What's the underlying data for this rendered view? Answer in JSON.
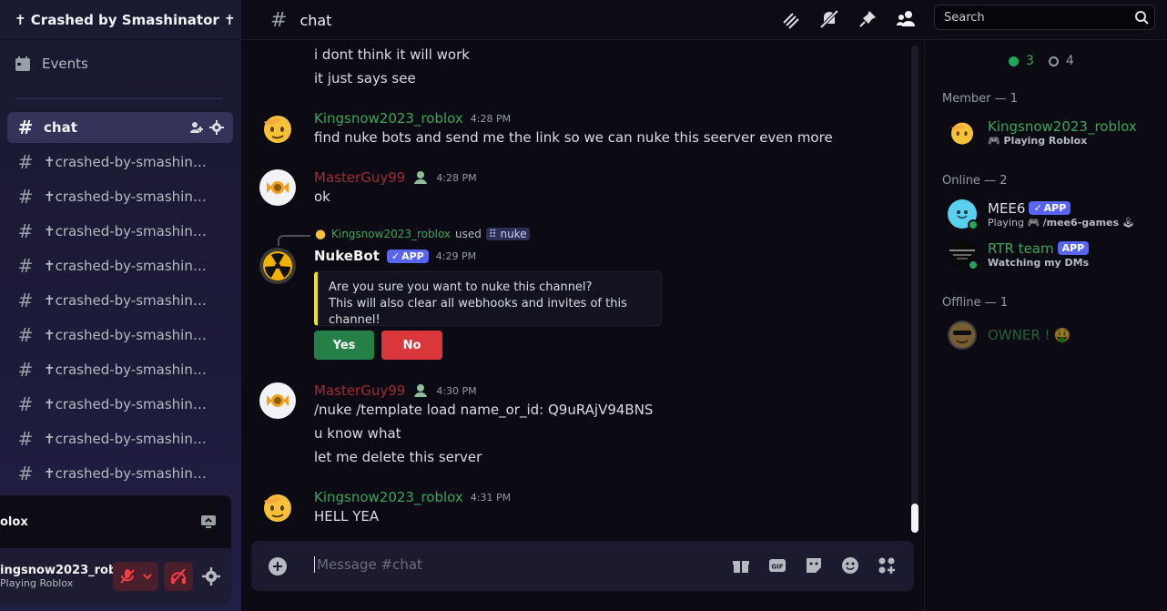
{
  "server": {
    "name": "✝ Crashed by Smashinator ✝"
  },
  "sidebar": {
    "events_label": "Events",
    "channels": [
      {
        "name": "chat",
        "active": true
      },
      {
        "name": "✝crashed-by-smashinator"
      },
      {
        "name": "✝crashed-by-smashinator"
      },
      {
        "name": "✝crashed-by-smashinator"
      },
      {
        "name": "✝crashed-by-smashinator"
      },
      {
        "name": "✝crashed-by-smashinator"
      },
      {
        "name": "✝crashed-by-smashinator"
      },
      {
        "name": "✝crashed-by-smashinator"
      },
      {
        "name": "✝crashed-by-smashinator"
      },
      {
        "name": "✝crashed-by-smashinator"
      },
      {
        "name": "✝crashed-by-smashinator"
      }
    ]
  },
  "user_panel": {
    "activity_name": "olox",
    "username": "ingsnow2023_rob...",
    "status": "Playing Roblox"
  },
  "header": {
    "channel": "chat",
    "search_placeholder": "Search"
  },
  "messages": {
    "m0_l1": "i dont think it will work",
    "m0_l2": "it just says see",
    "m1_author": "Kingsnow2023_roblox",
    "m1_time": "4:28 PM",
    "m1_text": "find nuke bots and send  me the link so we can nuke this seerver even more",
    "m2_author": "MasterGuy99",
    "m2_time": "4:28 PM",
    "m2_text": "ok",
    "m3_reply_user": "Kingsnow2023_roblox",
    "m3_reply_used": "used",
    "m3_reply_cmd": "nuke",
    "m3_author": "NukeBot",
    "m3_app": "APP",
    "m3_time": "4:29 PM",
    "m3_embed_l1": "Are you sure you want to nuke this channel?",
    "m3_embed_l2": "This will also clear all webhooks and invites of this channel!",
    "m3_yes": "Yes",
    "m3_no": "No",
    "m4_author": "MasterGuy99",
    "m4_time": "4:30 PM",
    "m4_l1": "/nuke /template load name_or_id: Q9uRAjV94BNS",
    "m4_l2": "u know what",
    "m4_l3": "let me delete this server",
    "m5_author": "Kingsnow2023_roblox",
    "m5_time": "4:31 PM",
    "m5_text": "HELL YEA"
  },
  "composer": {
    "placeholder": "Message #chat"
  },
  "members": {
    "online_count": "3",
    "offline_count": "4",
    "sec_member": "Member — 1",
    "sec_online": "Online — 2",
    "sec_offline": "Offline — 1",
    "kingsnow_name": "Kingsnow2023_roblox",
    "kingsnow_status": "Playing Roblox",
    "mee6_name": "MEE6",
    "mee6_app": "APP",
    "mee6_status_a": "Playing",
    "mee6_status_b": "/mee6-games",
    "rtr_name": "RTR team",
    "rtr_app": "APP",
    "rtr_status": "Watching my DMs",
    "owner_name": "OWNER !"
  },
  "colors": {
    "accent_green": "#3ba55d",
    "mastery_red": "#a32b33",
    "app_blurple": "#5865f2",
    "embed_yellow": "#f0e400"
  }
}
